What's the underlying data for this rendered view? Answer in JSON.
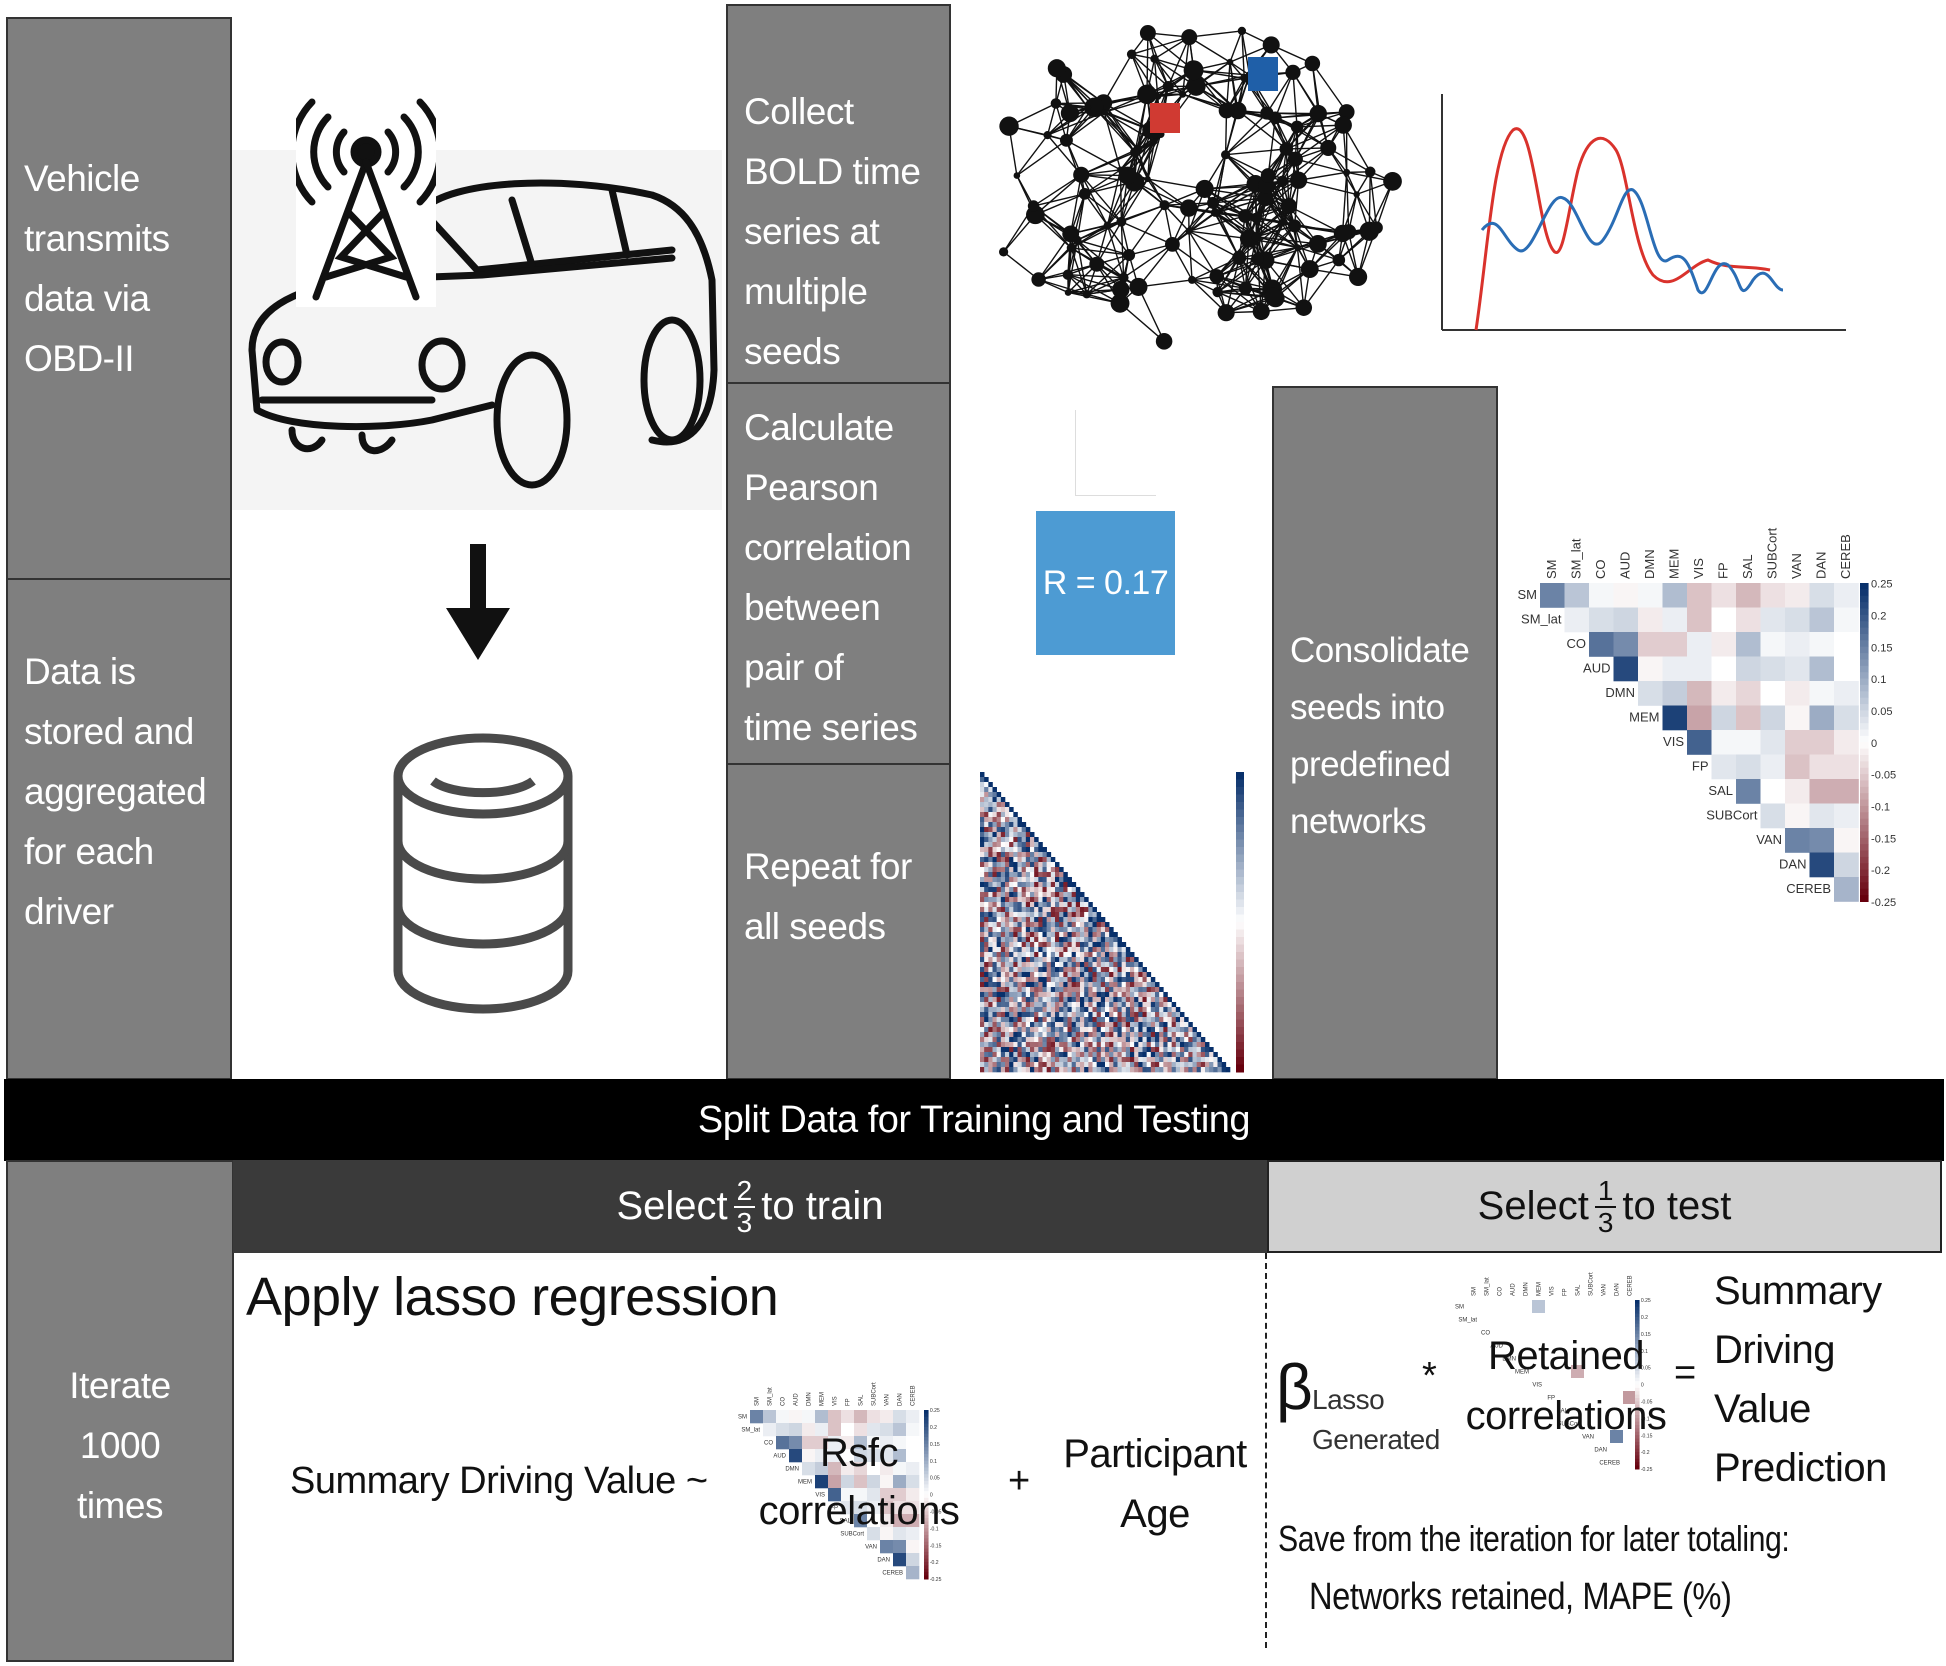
{
  "steps": {
    "vehicle": [
      "Vehicle",
      "transmits",
      "data via",
      "OBD-II"
    ],
    "storage": [
      "Data is",
      "stored and",
      "aggregated",
      "for each",
      "driver"
    ],
    "collect": [
      "Collect",
      "BOLD time",
      "series at",
      "multiple",
      "seeds"
    ],
    "pearson": [
      "Calculate",
      "Pearson",
      "correlation",
      "between",
      "pair of",
      "time series"
    ],
    "repeat": [
      "Repeat for",
      "all seeds"
    ],
    "consolidate": [
      "Consolidate",
      "seeds into",
      "predefined",
      "networks"
    ],
    "iterate": [
      "Iterate",
      "1000",
      "times"
    ]
  },
  "r_value_label": "R = 0.17",
  "split_bar": "Split Data for Training and Testing",
  "train": {
    "prefix": "Select",
    "numerator": "2",
    "denominator": "3",
    "suffix": "to train"
  },
  "test": {
    "prefix": "Select",
    "numerator": "1",
    "denominator": "3",
    "suffix": "to test"
  },
  "lasso": {
    "title": "Apply lasso regression",
    "lhs": "Summary Driving Value ~",
    "rsfc": [
      "Rsfc",
      "correlations"
    ],
    "plus": "+",
    "age": [
      "Participant",
      "Age"
    ]
  },
  "prediction": {
    "beta": "β",
    "beta_sub": [
      "Lasso",
      "Generated"
    ],
    "times": "*",
    "retained": [
      "Retained",
      "correlations"
    ],
    "equals": "=",
    "result": [
      "Summary",
      "Driving",
      "Value",
      "Prediction"
    ],
    "save_line": "Save from the iteration for later totaling:",
    "save_items": "Networks retained, MAPE (%)"
  },
  "colors": {
    "panel_gray": "#7f7f7f",
    "train_header": "#3a3a3a",
    "test_header": "#d0d0d0",
    "r_box": "#4d9bd3",
    "seed_red": "#d03a32",
    "seed_blue": "#1f5fa8",
    "series_red": "#d9322c",
    "series_blue": "#2a6db5"
  },
  "network_heatmap": {
    "labels": [
      "SM",
      "SM_lat",
      "CO",
      "AUD",
      "DMN",
      "MEM",
      "VIS",
      "FP",
      "SAL",
      "SUBCort",
      "VAN",
      "DAN",
      "CEREB"
    ],
    "colorbar_ticks": [
      "0.25",
      "0.2",
      "0.15",
      "0.1",
      "0.05",
      "0",
      "-0.05",
      "-0.1",
      "-0.15",
      "-0.2",
      "-0.25"
    ],
    "range": [
      -0.25,
      0.25
    ],
    "upper_triangle": [
      [
        0.15,
        0.07,
        0.01,
        -0.01,
        0.01,
        0.08,
        -0.06,
        -0.03,
        -0.07,
        -0.03,
        -0.02,
        0.04,
        0.02
      ],
      [
        0.02,
        0.04,
        0.05,
        -0.02,
        0.02,
        -0.06,
        0.0,
        -0.03,
        0.03,
        0.04,
        0.07,
        0.01
      ],
      [
        0.17,
        0.14,
        -0.05,
        -0.05,
        0.02,
        -0.02,
        0.08,
        0.01,
        0.02,
        0.01,
        0.0
      ],
      [
        0.22,
        -0.01,
        0.02,
        0.02,
        0.0,
        0.05,
        0.04,
        0.03,
        0.08,
        0.0
      ],
      [
        0.04,
        0.06,
        -0.07,
        -0.02,
        -0.04,
        0.0,
        -0.02,
        0.01,
        0.02
      ],
      [
        0.23,
        -0.09,
        0.05,
        -0.06,
        0.05,
        -0.01,
        0.1,
        0.04
      ],
      [
        0.19,
        0.01,
        0.01,
        0.03,
        -0.05,
        -0.05,
        -0.02
      ],
      [
        0.03,
        0.04,
        0.02,
        -0.06,
        -0.03,
        -0.03
      ],
      [
        0.15,
        0.0,
        -0.02,
        -0.08,
        -0.08
      ],
      [
        0.04,
        -0.01,
        0.03,
        0.02
      ],
      [
        0.15,
        0.14,
        -0.01
      ],
      [
        0.22,
        0.05
      ],
      [
        0.09
      ]
    ],
    "retained_cells": [
      [
        0,
        5,
        0.07
      ],
      [
        5,
        8,
        -0.08
      ],
      [
        7,
        12,
        -0.1
      ],
      [
        10,
        11,
        0.15
      ]
    ]
  }
}
